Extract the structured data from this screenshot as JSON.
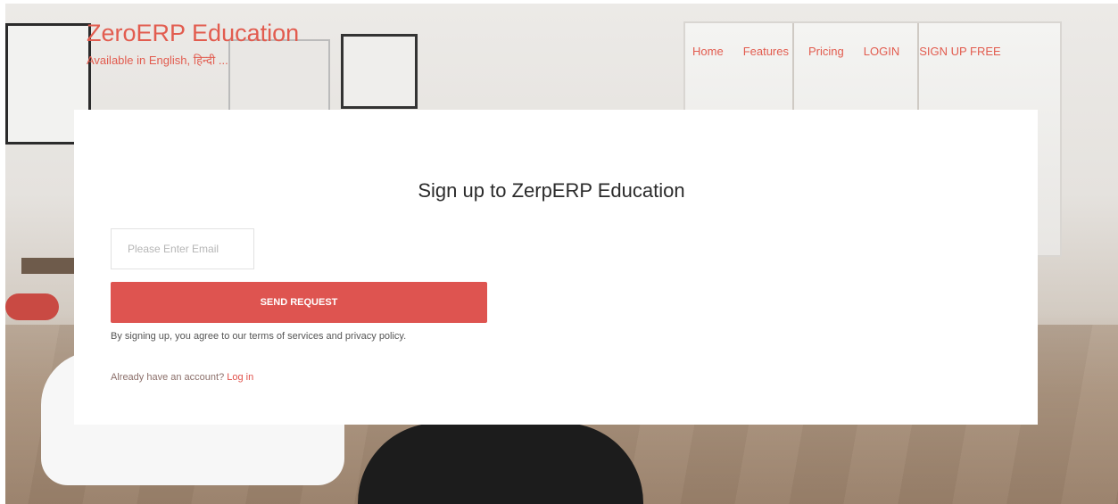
{
  "header": {
    "brand_title": "ZeroERP Education",
    "brand_subtitle": "Available in English, हिन्दी ...",
    "nav": [
      {
        "label": "Home"
      },
      {
        "label": "Features"
      },
      {
        "label": "Pricing"
      },
      {
        "label": "LOGIN"
      },
      {
        "label": "SIGN UP FREE"
      }
    ]
  },
  "signup": {
    "title": "Sign up to ZerpERP Education",
    "email_placeholder": "Please Enter Email",
    "email_value": "",
    "send_label": "SEND REQUEST",
    "terms_text": "By signing up, you agree to our terms of services and privacy policy.",
    "already_text": "Already have an account? ",
    "login_link": "Log in"
  },
  "colors": {
    "accent": "#e25c4f",
    "button": "#de5450",
    "card_bg": "#ffffff"
  }
}
